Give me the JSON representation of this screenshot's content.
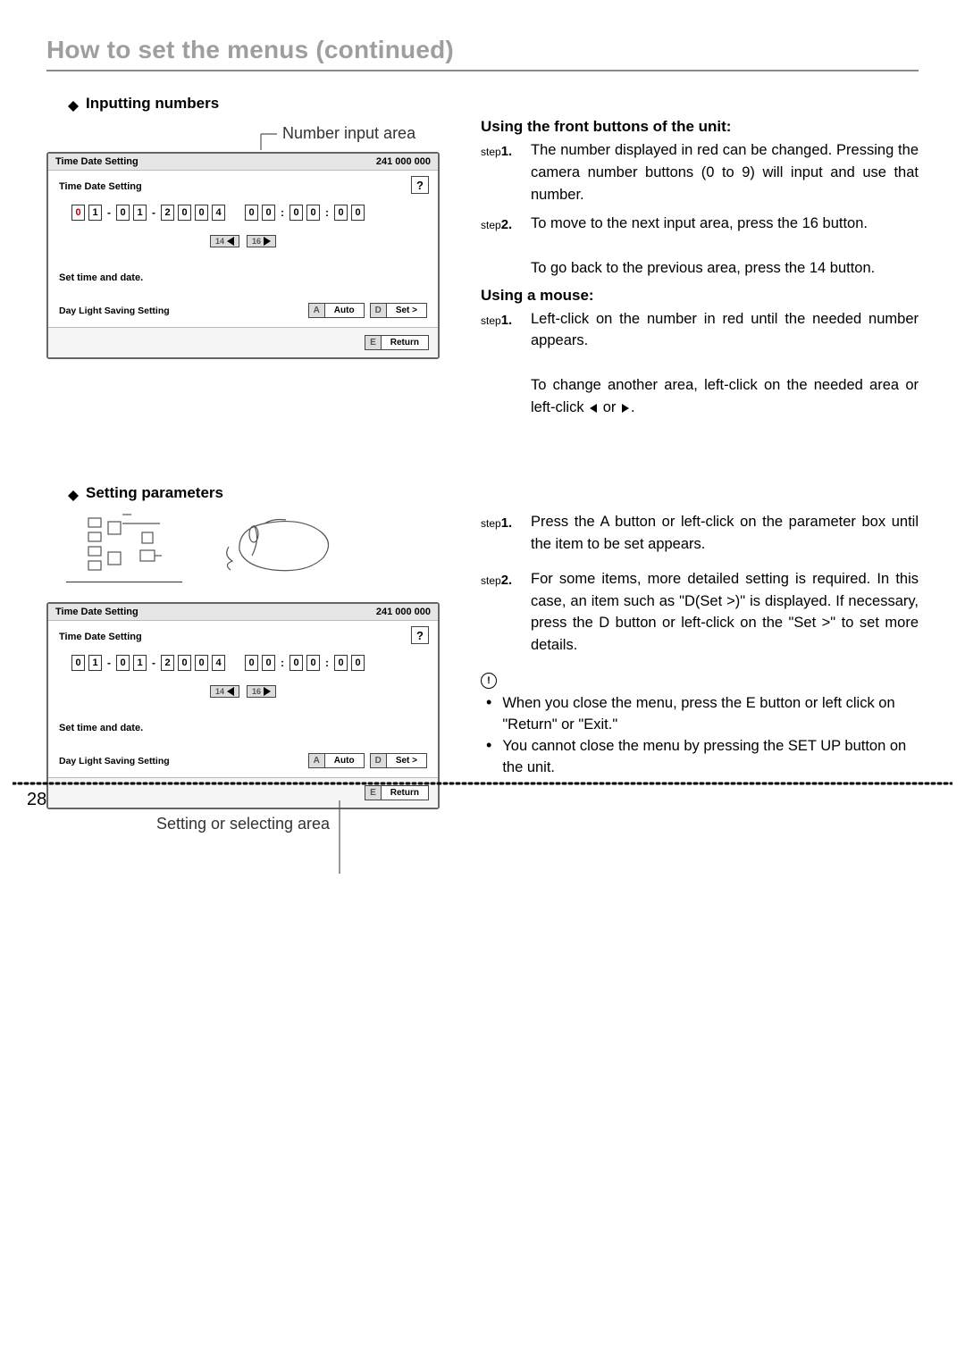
{
  "page_title": "How to set the menus (continued)",
  "page_number": "28",
  "section1": {
    "heading": "Inputting numbers",
    "caption": "Number input area",
    "panel": {
      "title": "Time Date Setting",
      "code": "241 000 000",
      "subtitle": "Time Date Setting",
      "help": "?",
      "date_digits": [
        "0",
        "1",
        "0",
        "1",
        "2",
        "0",
        "0",
        "4"
      ],
      "time_digits": [
        "0",
        "0",
        "0",
        "0",
        "0",
        "0"
      ],
      "date_sep": "-",
      "time_sep": ":",
      "nav14": "14",
      "nav16": "16",
      "hint": "Set time and date.",
      "dls_label": "Day Light Saving Setting",
      "btn_a_key": "A",
      "btn_a_val": "Auto",
      "btn_d_key": "D",
      "btn_d_val": "Set >",
      "btn_e_key": "E",
      "btn_e_val": "Return"
    },
    "right": {
      "h1": "Using the front buttons of the unit:",
      "s1_lbl_a": "step",
      "s1_lbl_b": "1.",
      "s1_body": "The number displayed in red can be changed. Pressing the camera number buttons (0 to 9) will input and use that number.",
      "s2_lbl_a": "step",
      "s2_lbl_b": "2.",
      "s2_body": "To move to the next input area, press the 16 button.",
      "s2_body2": "To go back to the previous area, press the 14 button.",
      "h2": "Using a mouse:",
      "m1_lbl_a": "step",
      "m1_lbl_b": "1.",
      "m1_body": "Left-click on the number in red until the needed number appears.",
      "m1_body2_a": "To change another area, left-click on the needed area or left-click ",
      "m1_body2_b": " or ",
      "m1_body2_c": "."
    }
  },
  "section2": {
    "heading": "Setting parameters",
    "panel": {
      "title": "Time Date Setting",
      "code": "241 000 000",
      "subtitle": "Time Date Setting",
      "help": "?",
      "date_digits": [
        "0",
        "1",
        "0",
        "1",
        "2",
        "0",
        "0",
        "4"
      ],
      "time_digits": [
        "0",
        "0",
        "0",
        "0",
        "0",
        "0"
      ],
      "date_sep": "-",
      "time_sep": ":",
      "nav14": "14",
      "nav16": "16",
      "hint": "Set time and date.",
      "dls_label": "Day Light Saving Setting",
      "btn_a_key": "A",
      "btn_a_val": "Auto",
      "btn_d_key": "D",
      "btn_d_val": "Set >",
      "btn_e_key": "E",
      "btn_e_val": "Return"
    },
    "caption": "Setting or selecting area",
    "right": {
      "s1_lbl_a": "step",
      "s1_lbl_b": "1.",
      "s1_body": "Press the A button or left-click on the parameter box until the item to be set appears.",
      "s2_lbl_a": "step",
      "s2_lbl_b": "2.",
      "s2_body": "For some items, more detailed setting is required. In this case, an item such as \"D(Set >)\" is displayed. If necessary, press the D button or left-click on the \"Set >\" to set more details.",
      "info": "!",
      "n1": "When you close the menu, press the E button or left click on \"Return\" or \"Exit.\"",
      "n2": "You cannot close the menu by pressing the SET UP button on the unit."
    }
  }
}
